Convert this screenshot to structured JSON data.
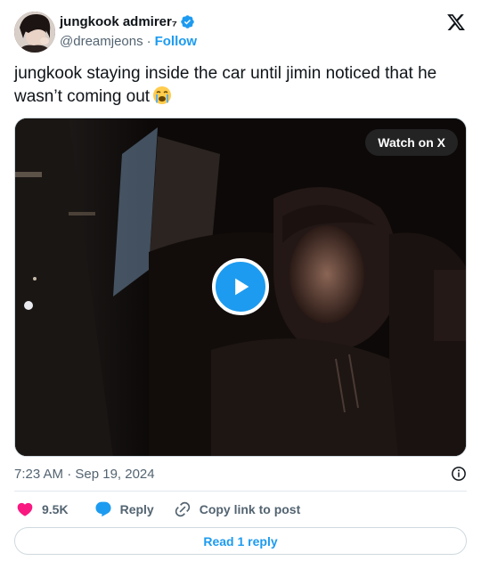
{
  "author": {
    "display_name": "jungkook admirer₇",
    "handle": "@dreamjeons",
    "separator": "·",
    "follow_label": "Follow",
    "verified": true,
    "verified_color": "#1d9bf0"
  },
  "platform_logo": "x-logo-icon",
  "tweet": {
    "text": "jungkook staying inside the car until jimin noticed that he wasn’t coming out",
    "emoji": "loudly-crying-face-icon"
  },
  "media": {
    "watch_label": "Watch on X",
    "play_icon": "play-icon",
    "accent": "#1d9bf0"
  },
  "meta": {
    "timestamp": "7:23 AM · Sep 19, 2024",
    "info_icon": "info-icon"
  },
  "actions": {
    "like_count": "9.5K",
    "like_color": "#f91880",
    "reply_label": "Reply",
    "reply_color": "#1d9bf0",
    "copy_label": "Copy link to post"
  },
  "read_reply_label": "Read 1 reply"
}
